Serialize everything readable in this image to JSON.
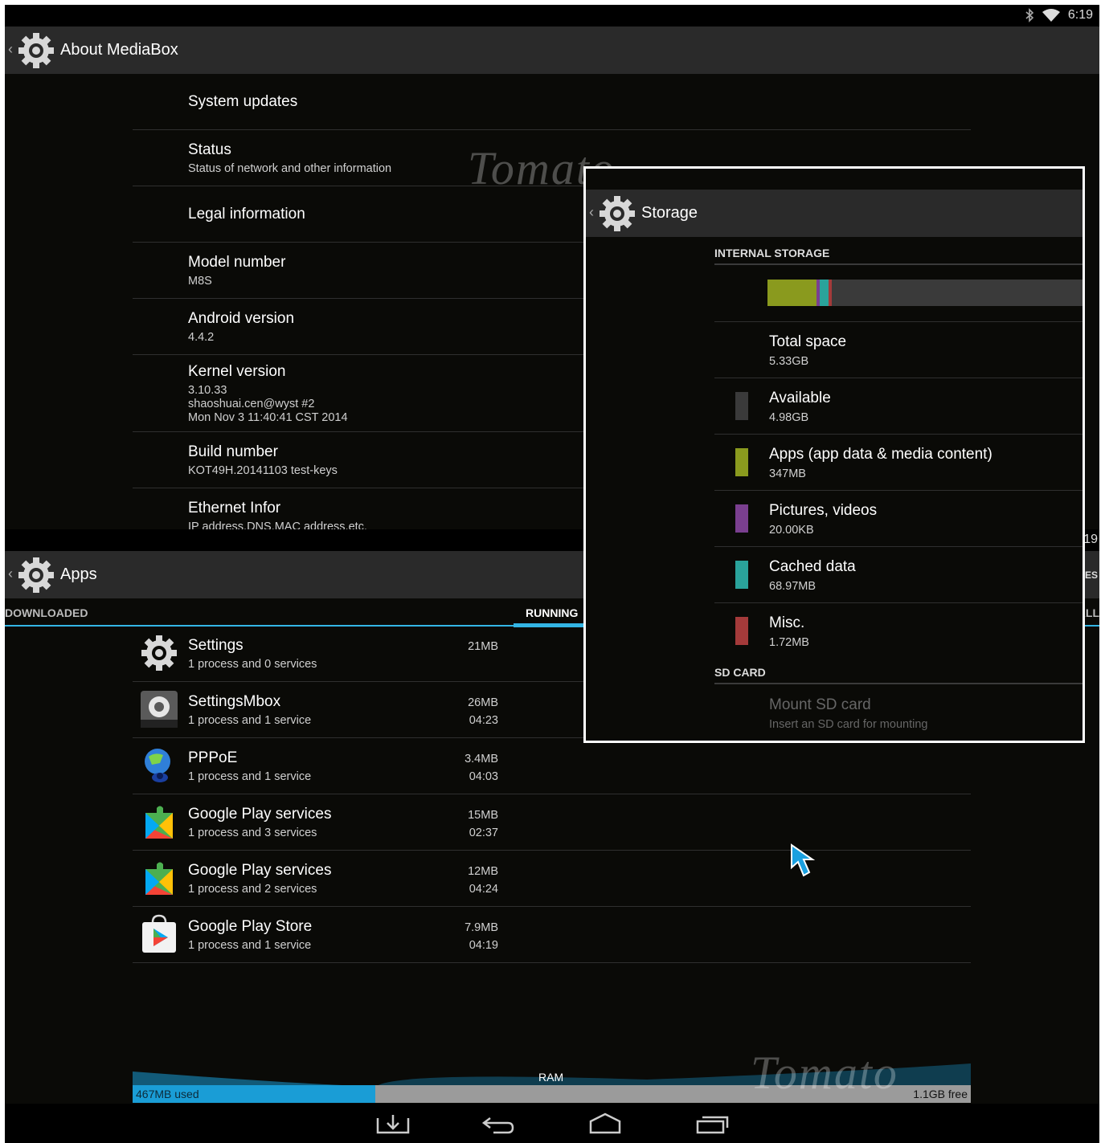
{
  "status_bar": {
    "time": "6:19",
    "bluetooth_icon": "bluetooth-icon",
    "wifi_icon": "wifi-icon"
  },
  "about": {
    "title": "About MediaBox",
    "items": [
      {
        "title": "System updates",
        "summary": ""
      },
      {
        "title": "Status",
        "summary": "Status of network and other information"
      },
      {
        "title": "Legal information",
        "summary": ""
      },
      {
        "title": "Model number",
        "summary": "M8S"
      },
      {
        "title": "Android version",
        "summary": "4.4.2"
      },
      {
        "title": "Kernel version",
        "summary": "3.10.33\nshaoshuai.cen@wyst #2\nMon Nov 3 11:40:41 CST 2014"
      },
      {
        "title": "Build number",
        "summary": "KOT49H.20141103 test-keys"
      },
      {
        "title": "Ethernet Infor",
        "summary": "IP address,DNS,MAC address,etc."
      }
    ]
  },
  "apps": {
    "title": "Apps",
    "tabs": {
      "downloaded": "DOWNLOADED",
      "running": "RUNNING",
      "right_partial": "ES",
      "all_partial": "ALL"
    },
    "partial_time": "19",
    "running": [
      {
        "name": "Settings",
        "detail": "1 process and 0 services",
        "memory": "21MB",
        "time": "",
        "icon": "settings-gear-icon"
      },
      {
        "name": "SettingsMbox",
        "detail": "1 process and 1 service",
        "memory": "26MB",
        "time": "04:23",
        "icon": "settings-mbox-icon"
      },
      {
        "name": "PPPoE",
        "detail": "1 process and 1 service",
        "memory": "3.4MB",
        "time": "04:03",
        "icon": "globe-network-icon"
      },
      {
        "name": "Google Play services",
        "detail": "1 process and 3 services",
        "memory": "15MB",
        "time": "02:37",
        "icon": "play-services-puzzle-icon"
      },
      {
        "name": "Google Play services",
        "detail": "1 process and 2 services",
        "memory": "12MB",
        "time": "04:24",
        "icon": "play-services-puzzle-icon"
      },
      {
        "name": "Google Play Store",
        "detail": "1 process and 1 service",
        "memory": "7.9MB",
        "time": "04:19",
        "icon": "play-store-bag-icon"
      }
    ],
    "ram": {
      "label": "RAM",
      "used": "467MB used",
      "free": "1.1GB free",
      "used_fraction": 0.29
    }
  },
  "storage": {
    "title": "Storage",
    "internal_header": "INTERNAL STORAGE",
    "usage_segments": [
      {
        "name": "Apps",
        "color": "#8a9a1e",
        "fraction": 0.155
      },
      {
        "name": "Pictures, videos",
        "color": "#7a3f8f",
        "fraction": 0.01
      },
      {
        "name": "Cached data",
        "color": "#2aa39b",
        "fraction": 0.028
      },
      {
        "name": "Misc.",
        "color": "#a43a3a",
        "fraction": 0.012
      }
    ],
    "items": [
      {
        "title": "Total space",
        "value": "5.33GB",
        "color": ""
      },
      {
        "title": "Available",
        "value": "4.98GB",
        "color": "#3a3a3a"
      },
      {
        "title": "Apps (app data & media content)",
        "value": "347MB",
        "color": "#8a9a1e"
      },
      {
        "title": "Pictures, videos",
        "value": "20.00KB",
        "color": "#7a3f8f"
      },
      {
        "title": "Cached data",
        "value": "68.97MB",
        "color": "#2aa39b"
      },
      {
        "title": "Misc.",
        "value": "1.72MB",
        "color": "#a43a3a"
      }
    ],
    "sd_header": "SD CARD",
    "sd_item": {
      "title": "Mount SD card",
      "summary": "Insert an SD card for mounting"
    }
  },
  "watermark_text": "Tomato",
  "nav": {
    "download": "download-icon",
    "back": "back-icon",
    "home": "home-icon",
    "recents": "recents-icon"
  },
  "colors": {
    "accent": "#33b5e5",
    "background": "#0a0a07",
    "actionbar": "#2a2a2a"
  }
}
